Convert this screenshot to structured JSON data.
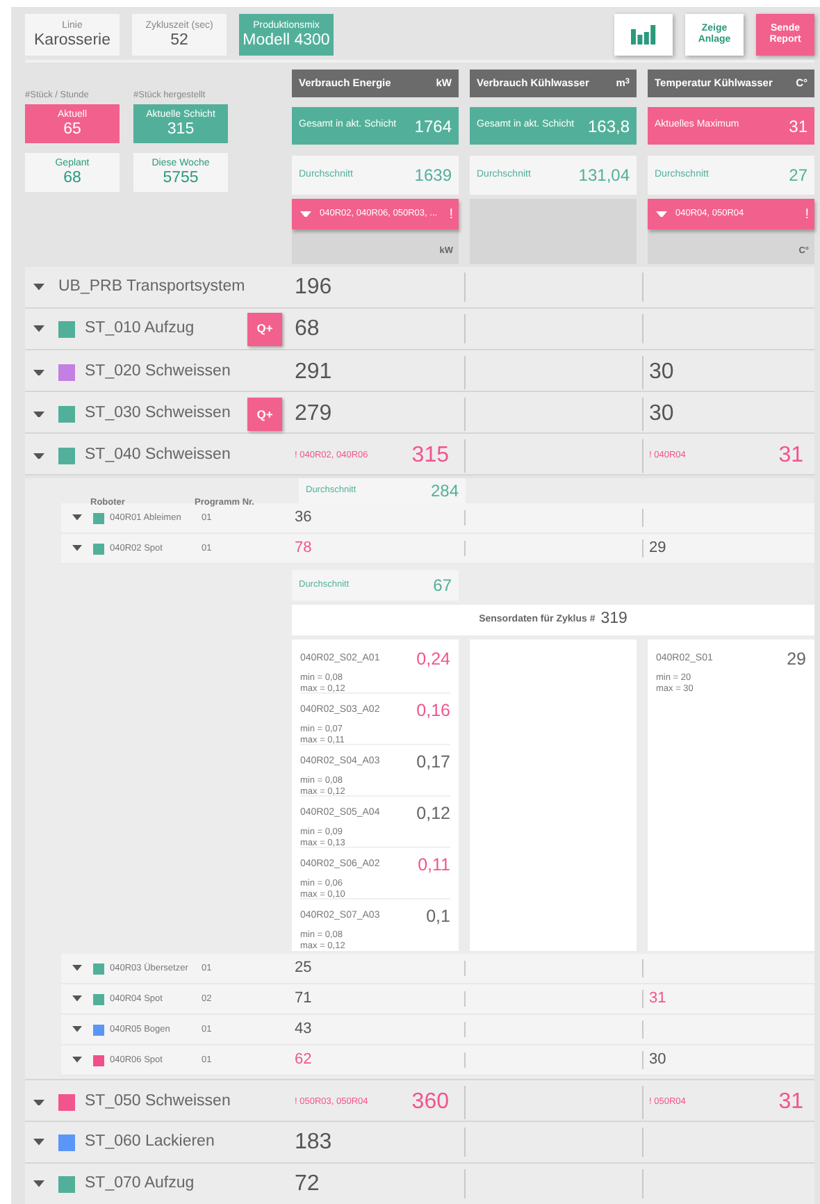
{
  "header": {
    "fields": [
      {
        "label": "Linie",
        "value": "Karosserie",
        "kind": "plain"
      },
      {
        "label": "Zykluszeit (sec)",
        "value": "52",
        "kind": "plain"
      },
      {
        "label": "Produktionsmix",
        "value": "Modell 4300",
        "kind": "accent"
      }
    ],
    "buttons": [
      {
        "kind": "chart"
      },
      {
        "kind": "text",
        "label": "Zeige Anlage"
      },
      {
        "kind": "alert",
        "label": "Sende Report"
      }
    ]
  },
  "production": [
    {
      "title": "#Stück / Stunde",
      "tiles": [
        {
          "label": "Aktuell",
          "value": "65",
          "kind": "alert"
        },
        {
          "label": "Geplant",
          "value": "68",
          "kind": "plain"
        }
      ]
    },
    {
      "title": "#Stück hergestellt",
      "tiles": [
        {
          "label": "Aktuelle Schicht",
          "value": "315",
          "kind": "ok"
        },
        {
          "label": "Diese Woche",
          "value": "5755",
          "kind": "plain"
        }
      ]
    }
  ],
  "metrics": [
    {
      "title": "Verbrauch Energie",
      "unit": "kW",
      "total": {
        "label": "Gesamt in akt. Schicht",
        "value": "1764",
        "kind": "ok"
      },
      "average": {
        "label": "Durchschnitt",
        "value": "1639"
      },
      "alert": {
        "text": "040R02, 040R06, 050R03, ...",
        "mark": "!"
      },
      "footer_unit": "kW"
    },
    {
      "title": "Verbrauch Kühlwasser",
      "unit": "m$^{3}$",
      "total": {
        "label": "Gesamt in akt. Schicht",
        "value": "163,8",
        "kind": "ok"
      },
      "average": {
        "label": "Durchschnitt",
        "value": "131,04"
      }
    },
    {
      "title": "Temperatur Kühlwasser",
      "unit": "C°",
      "total": {
        "label": "Aktuelles Maximum",
        "value": "31",
        "kind": "alert"
      },
      "average": {
        "label": "Durchschnitt",
        "value": "27"
      },
      "alert": {
        "text": "040R04, 050R04",
        "mark": "!"
      },
      "footer_unit": "C°"
    }
  ],
  "stations": [
    {
      "name": "UB_PRB Transportsystem",
      "energy": "196",
      "energy_alert": false
    },
    {
      "name": "ST_010 Aufzug",
      "color": "#52b09a",
      "quality": "Q+",
      "energy": "68",
      "energy_alert": false
    },
    {
      "name": "ST_020 Schweissen",
      "color": "#c37fe3",
      "energy": "291",
      "energy_alert": false,
      "temp": "30",
      "temp_alert": false
    },
    {
      "name": "ST_030 Schweissen",
      "color": "#52b09a",
      "quality": "Q+",
      "energy": "279",
      "energy_alert": false,
      "temp": "30",
      "temp_alert": false
    },
    {
      "name": "ST_040 Schweissen",
      "color": "#52b09a",
      "energy_warning": "! 040R02, 040R06",
      "energy": "315",
      "energy_alert": true,
      "temp_warning": "! 040R04",
      "temp": "31",
      "temp_alert": true,
      "details": {
        "average": {
          "label": "Durchschnitt",
          "value": "284"
        },
        "columns": [
          "Roboter",
          "Programm Nr."
        ],
        "robots": [
          {
            "name": "040R01 Ableimen",
            "color": "#52b09a",
            "program": "01",
            "energy": "36",
            "energy_alert": false
          },
          {
            "name": "040R02 Spot",
            "color": "#52b09a",
            "program": "01",
            "energy": "78",
            "energy_alert": true,
            "temp": "29",
            "temp_alert": false,
            "details": {
              "average": {
                "label": "Durchschnitt",
                "value": "67"
              },
              "sensor_title": "Sensordaten für Zyklus #",
              "cycle": "319",
              "energy_sensors": [
                {
                  "name": "040R02_S02_A01",
                  "value": "0,24",
                  "alert": true,
                  "min": "min = 0,08",
                  "max": "max = 0,12"
                },
                {
                  "name": "040R02_S03_A02",
                  "value": "0,16",
                  "alert": true,
                  "min": "min = 0,07",
                  "max": "max = 0,11"
                },
                {
                  "name": "040R02_S04_A03",
                  "value": "0,17",
                  "alert": false,
                  "min": "min = 0,08",
                  "max": "max = 0,12"
                },
                {
                  "name": "040R02_S05_A04",
                  "value": "0,12",
                  "alert": false,
                  "min": "min = 0,09",
                  "max": "max = 0,13"
                },
                {
                  "name": "040R02_S06_A02",
                  "value": "0,11",
                  "alert": true,
                  "min": "min = 0,06",
                  "max": "max = 0,10"
                },
                {
                  "name": "040R02_S07_A03",
                  "value": "0,1",
                  "alert": false,
                  "min": "min = 0,08",
                  "max": "max = 0,12"
                }
              ],
              "temp_sensors": [
                {
                  "name": "040R02_S01",
                  "value": "29",
                  "alert": false,
                  "min": "min = 20",
                  "max": "max = 30"
                }
              ]
            }
          },
          {
            "name": "040R03 Übersetzer",
            "color": "#52b09a",
            "program": "01",
            "energy": "25",
            "energy_alert": false
          },
          {
            "name": "040R04 Spot",
            "color": "#52b09a",
            "program": "02",
            "energy": "71",
            "energy_alert": false,
            "temp": "31",
            "temp_alert": true
          },
          {
            "name": "040R05 Bogen",
            "color": "#5b96f7",
            "program": "01",
            "energy": "43",
            "energy_alert": false
          },
          {
            "name": "040R06 Spot",
            "color": "#f0508a",
            "program": "01",
            "energy": "62",
            "energy_alert": true,
            "temp": "30",
            "temp_alert": false
          }
        ]
      }
    },
    {
      "name": "ST_050 Schweissen",
      "color": "#f2548e",
      "energy_warning": "! 050R03, 050R04",
      "energy": "360",
      "energy_alert": true,
      "temp_warning": "! 050R04",
      "temp": "31",
      "temp_alert": true
    },
    {
      "name": "ST_060 Lackieren",
      "color": "#5b96f7",
      "energy": "183",
      "energy_alert": false
    },
    {
      "name": "ST_070 Aufzug",
      "color": "#52b09a",
      "energy": "72",
      "energy_alert": false
    }
  ]
}
